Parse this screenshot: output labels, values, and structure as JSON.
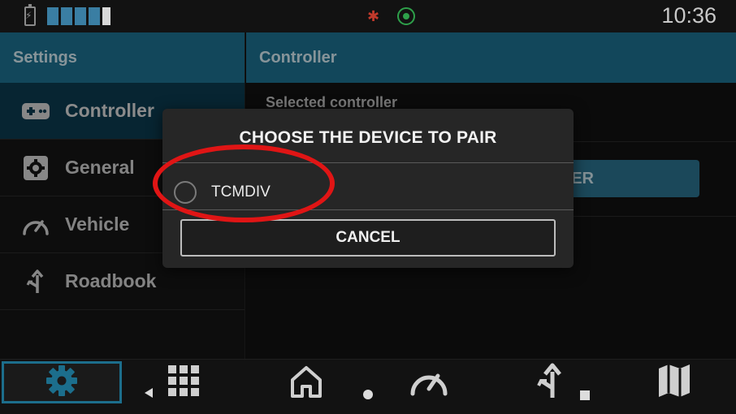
{
  "status_bar": {
    "time": "10:36",
    "icons": [
      "battery-charging-icon",
      "signal-icon",
      "bluetooth-off-icon",
      "gps-icon"
    ]
  },
  "sidebar": {
    "header": "Settings",
    "items": [
      {
        "label": "Controller",
        "icon": "gamepad-icon",
        "active": true
      },
      {
        "label": "General",
        "icon": "gear-icon",
        "active": false
      },
      {
        "label": "Vehicle",
        "icon": "speedometer-icon",
        "active": false
      },
      {
        "label": "Roadbook",
        "icon": "route-icon",
        "active": false
      }
    ]
  },
  "main": {
    "header": "Controller",
    "selected_controller_label": "Selected controller",
    "pair_button_label": "ER"
  },
  "dialog": {
    "title": "CHOOSE THE DEVICE TO PAIR",
    "options": [
      {
        "label": "TCMDIV",
        "selected": false
      }
    ],
    "cancel_label": "CANCEL"
  },
  "bottom_nav": {
    "items": [
      "settings-icon",
      "back-icon",
      "apps-grid-icon",
      "home-icon",
      "home-dot-icon",
      "speedometer-icon",
      "route-icon",
      "recents-icon",
      "map-icon"
    ]
  },
  "colors": {
    "accent": "#1c6e8c",
    "active_item": "#0c3a4e",
    "annotation": "#e01515",
    "bluetooth": "#c0392b",
    "gps": "#2ea04a"
  }
}
